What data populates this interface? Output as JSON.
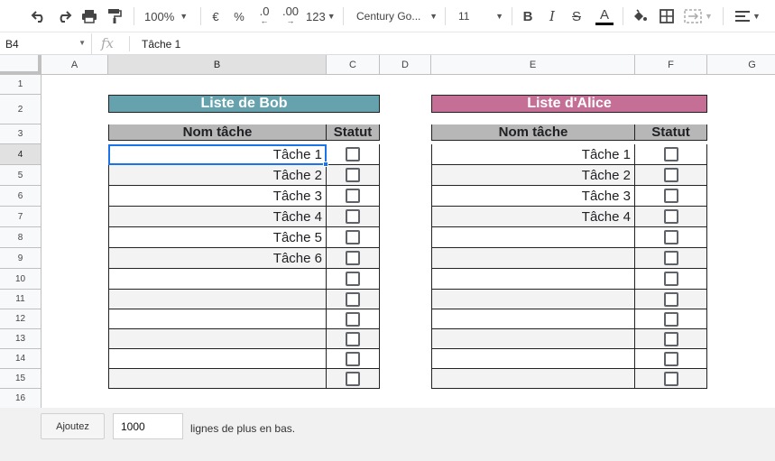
{
  "toolbar": {
    "zoom": "100%",
    "currency": "€",
    "percent": "%",
    "dec_decrease": ".0",
    "dec_increase": ".00",
    "number_format": "123",
    "font": "Century Go...",
    "font_size": "11",
    "bold": "B",
    "italic": "I",
    "strike": "S",
    "text_color": "A"
  },
  "formula_bar": {
    "cell_ref": "B4",
    "fx": "fx",
    "content": "Tâche 1"
  },
  "columns": [
    "A",
    "B",
    "C",
    "D",
    "E",
    "F",
    "G"
  ],
  "rows": [
    "1",
    "2",
    "3",
    "4",
    "5",
    "6",
    "7",
    "8",
    "9",
    "10",
    "11",
    "12",
    "13",
    "14",
    "15",
    "16"
  ],
  "bob": {
    "title": "Liste de Bob",
    "title_color": "#66a2ad",
    "col_name": "Nom tâche",
    "col_status": "Statut",
    "tasks": [
      "Tâche 1",
      "Tâche 2",
      "Tâche 3",
      "Tâche 4",
      "Tâche 5",
      "Tâche 6",
      "",
      "",
      "",
      "",
      "",
      ""
    ]
  },
  "alice": {
    "title": "Liste d'Alice",
    "title_color": "#c56f97",
    "col_name": "Nom tâche",
    "col_status": "Statut",
    "tasks": [
      "Tâche 1",
      "Tâche 2",
      "Tâche 3",
      "Tâche 4",
      "",
      "",
      "",
      "",
      "",
      "",
      "",
      ""
    ]
  },
  "bottom": {
    "add_button": "Ajoutez",
    "add_count": "1000",
    "add_text": "lignes de plus en bas."
  }
}
